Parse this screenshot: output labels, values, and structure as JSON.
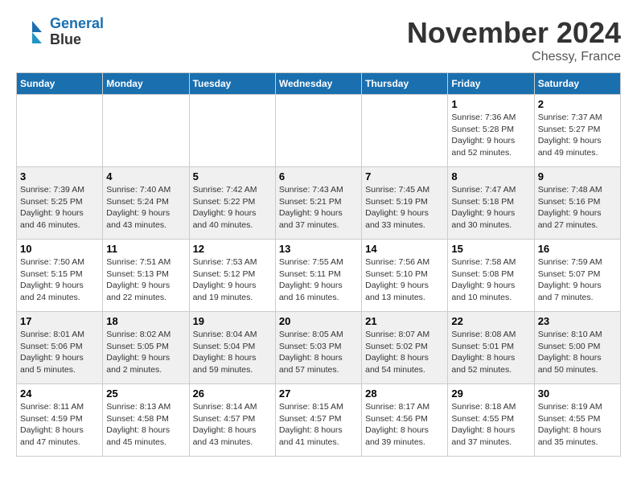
{
  "logo": {
    "line1": "General",
    "line2": "Blue"
  },
  "header": {
    "month": "November 2024",
    "location": "Chessy, France"
  },
  "weekdays": [
    "Sunday",
    "Monday",
    "Tuesday",
    "Wednesday",
    "Thursday",
    "Friday",
    "Saturday"
  ],
  "weeks": [
    [
      {
        "day": "",
        "info": ""
      },
      {
        "day": "",
        "info": ""
      },
      {
        "day": "",
        "info": ""
      },
      {
        "day": "",
        "info": ""
      },
      {
        "day": "",
        "info": ""
      },
      {
        "day": "1",
        "info": "Sunrise: 7:36 AM\nSunset: 5:28 PM\nDaylight: 9 hours and 52 minutes."
      },
      {
        "day": "2",
        "info": "Sunrise: 7:37 AM\nSunset: 5:27 PM\nDaylight: 9 hours and 49 minutes."
      }
    ],
    [
      {
        "day": "3",
        "info": "Sunrise: 7:39 AM\nSunset: 5:25 PM\nDaylight: 9 hours and 46 minutes."
      },
      {
        "day": "4",
        "info": "Sunrise: 7:40 AM\nSunset: 5:24 PM\nDaylight: 9 hours and 43 minutes."
      },
      {
        "day": "5",
        "info": "Sunrise: 7:42 AM\nSunset: 5:22 PM\nDaylight: 9 hours and 40 minutes."
      },
      {
        "day": "6",
        "info": "Sunrise: 7:43 AM\nSunset: 5:21 PM\nDaylight: 9 hours and 37 minutes."
      },
      {
        "day": "7",
        "info": "Sunrise: 7:45 AM\nSunset: 5:19 PM\nDaylight: 9 hours and 33 minutes."
      },
      {
        "day": "8",
        "info": "Sunrise: 7:47 AM\nSunset: 5:18 PM\nDaylight: 9 hours and 30 minutes."
      },
      {
        "day": "9",
        "info": "Sunrise: 7:48 AM\nSunset: 5:16 PM\nDaylight: 9 hours and 27 minutes."
      }
    ],
    [
      {
        "day": "10",
        "info": "Sunrise: 7:50 AM\nSunset: 5:15 PM\nDaylight: 9 hours and 24 minutes."
      },
      {
        "day": "11",
        "info": "Sunrise: 7:51 AM\nSunset: 5:13 PM\nDaylight: 9 hours and 22 minutes."
      },
      {
        "day": "12",
        "info": "Sunrise: 7:53 AM\nSunset: 5:12 PM\nDaylight: 9 hours and 19 minutes."
      },
      {
        "day": "13",
        "info": "Sunrise: 7:55 AM\nSunset: 5:11 PM\nDaylight: 9 hours and 16 minutes."
      },
      {
        "day": "14",
        "info": "Sunrise: 7:56 AM\nSunset: 5:10 PM\nDaylight: 9 hours and 13 minutes."
      },
      {
        "day": "15",
        "info": "Sunrise: 7:58 AM\nSunset: 5:08 PM\nDaylight: 9 hours and 10 minutes."
      },
      {
        "day": "16",
        "info": "Sunrise: 7:59 AM\nSunset: 5:07 PM\nDaylight: 9 hours and 7 minutes."
      }
    ],
    [
      {
        "day": "17",
        "info": "Sunrise: 8:01 AM\nSunset: 5:06 PM\nDaylight: 9 hours and 5 minutes."
      },
      {
        "day": "18",
        "info": "Sunrise: 8:02 AM\nSunset: 5:05 PM\nDaylight: 9 hours and 2 minutes."
      },
      {
        "day": "19",
        "info": "Sunrise: 8:04 AM\nSunset: 5:04 PM\nDaylight: 8 hours and 59 minutes."
      },
      {
        "day": "20",
        "info": "Sunrise: 8:05 AM\nSunset: 5:03 PM\nDaylight: 8 hours and 57 minutes."
      },
      {
        "day": "21",
        "info": "Sunrise: 8:07 AM\nSunset: 5:02 PM\nDaylight: 8 hours and 54 minutes."
      },
      {
        "day": "22",
        "info": "Sunrise: 8:08 AM\nSunset: 5:01 PM\nDaylight: 8 hours and 52 minutes."
      },
      {
        "day": "23",
        "info": "Sunrise: 8:10 AM\nSunset: 5:00 PM\nDaylight: 8 hours and 50 minutes."
      }
    ],
    [
      {
        "day": "24",
        "info": "Sunrise: 8:11 AM\nSunset: 4:59 PM\nDaylight: 8 hours and 47 minutes."
      },
      {
        "day": "25",
        "info": "Sunrise: 8:13 AM\nSunset: 4:58 PM\nDaylight: 8 hours and 45 minutes."
      },
      {
        "day": "26",
        "info": "Sunrise: 8:14 AM\nSunset: 4:57 PM\nDaylight: 8 hours and 43 minutes."
      },
      {
        "day": "27",
        "info": "Sunrise: 8:15 AM\nSunset: 4:57 PM\nDaylight: 8 hours and 41 minutes."
      },
      {
        "day": "28",
        "info": "Sunrise: 8:17 AM\nSunset: 4:56 PM\nDaylight: 8 hours and 39 minutes."
      },
      {
        "day": "29",
        "info": "Sunrise: 8:18 AM\nSunset: 4:55 PM\nDaylight: 8 hours and 37 minutes."
      },
      {
        "day": "30",
        "info": "Sunrise: 8:19 AM\nSunset: 4:55 PM\nDaylight: 8 hours and 35 minutes."
      }
    ]
  ]
}
